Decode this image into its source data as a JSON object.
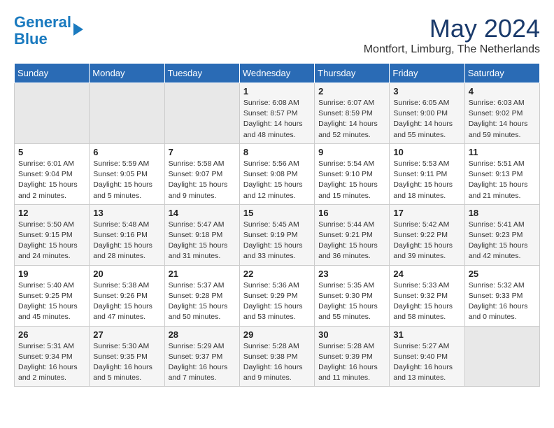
{
  "logo": {
    "line1": "General",
    "line2": "Blue"
  },
  "title": "May 2024",
  "location": "Montfort, Limburg, The Netherlands",
  "days_of_week": [
    "Sunday",
    "Monday",
    "Tuesday",
    "Wednesday",
    "Thursday",
    "Friday",
    "Saturday"
  ],
  "weeks": [
    [
      {
        "day": "",
        "info": ""
      },
      {
        "day": "",
        "info": ""
      },
      {
        "day": "",
        "info": ""
      },
      {
        "day": "1",
        "info": "Sunrise: 6:08 AM\nSunset: 8:57 PM\nDaylight: 14 hours\nand 48 minutes."
      },
      {
        "day": "2",
        "info": "Sunrise: 6:07 AM\nSunset: 8:59 PM\nDaylight: 14 hours\nand 52 minutes."
      },
      {
        "day": "3",
        "info": "Sunrise: 6:05 AM\nSunset: 9:00 PM\nDaylight: 14 hours\nand 55 minutes."
      },
      {
        "day": "4",
        "info": "Sunrise: 6:03 AM\nSunset: 9:02 PM\nDaylight: 14 hours\nand 59 minutes."
      }
    ],
    [
      {
        "day": "5",
        "info": "Sunrise: 6:01 AM\nSunset: 9:04 PM\nDaylight: 15 hours\nand 2 minutes."
      },
      {
        "day": "6",
        "info": "Sunrise: 5:59 AM\nSunset: 9:05 PM\nDaylight: 15 hours\nand 5 minutes."
      },
      {
        "day": "7",
        "info": "Sunrise: 5:58 AM\nSunset: 9:07 PM\nDaylight: 15 hours\nand 9 minutes."
      },
      {
        "day": "8",
        "info": "Sunrise: 5:56 AM\nSunset: 9:08 PM\nDaylight: 15 hours\nand 12 minutes."
      },
      {
        "day": "9",
        "info": "Sunrise: 5:54 AM\nSunset: 9:10 PM\nDaylight: 15 hours\nand 15 minutes."
      },
      {
        "day": "10",
        "info": "Sunrise: 5:53 AM\nSunset: 9:11 PM\nDaylight: 15 hours\nand 18 minutes."
      },
      {
        "day": "11",
        "info": "Sunrise: 5:51 AM\nSunset: 9:13 PM\nDaylight: 15 hours\nand 21 minutes."
      }
    ],
    [
      {
        "day": "12",
        "info": "Sunrise: 5:50 AM\nSunset: 9:15 PM\nDaylight: 15 hours\nand 24 minutes."
      },
      {
        "day": "13",
        "info": "Sunrise: 5:48 AM\nSunset: 9:16 PM\nDaylight: 15 hours\nand 28 minutes."
      },
      {
        "day": "14",
        "info": "Sunrise: 5:47 AM\nSunset: 9:18 PM\nDaylight: 15 hours\nand 31 minutes."
      },
      {
        "day": "15",
        "info": "Sunrise: 5:45 AM\nSunset: 9:19 PM\nDaylight: 15 hours\nand 33 minutes."
      },
      {
        "day": "16",
        "info": "Sunrise: 5:44 AM\nSunset: 9:21 PM\nDaylight: 15 hours\nand 36 minutes."
      },
      {
        "day": "17",
        "info": "Sunrise: 5:42 AM\nSunset: 9:22 PM\nDaylight: 15 hours\nand 39 minutes."
      },
      {
        "day": "18",
        "info": "Sunrise: 5:41 AM\nSunset: 9:23 PM\nDaylight: 15 hours\nand 42 minutes."
      }
    ],
    [
      {
        "day": "19",
        "info": "Sunrise: 5:40 AM\nSunset: 9:25 PM\nDaylight: 15 hours\nand 45 minutes."
      },
      {
        "day": "20",
        "info": "Sunrise: 5:38 AM\nSunset: 9:26 PM\nDaylight: 15 hours\nand 47 minutes."
      },
      {
        "day": "21",
        "info": "Sunrise: 5:37 AM\nSunset: 9:28 PM\nDaylight: 15 hours\nand 50 minutes."
      },
      {
        "day": "22",
        "info": "Sunrise: 5:36 AM\nSunset: 9:29 PM\nDaylight: 15 hours\nand 53 minutes."
      },
      {
        "day": "23",
        "info": "Sunrise: 5:35 AM\nSunset: 9:30 PM\nDaylight: 15 hours\nand 55 minutes."
      },
      {
        "day": "24",
        "info": "Sunrise: 5:33 AM\nSunset: 9:32 PM\nDaylight: 15 hours\nand 58 minutes."
      },
      {
        "day": "25",
        "info": "Sunrise: 5:32 AM\nSunset: 9:33 PM\nDaylight: 16 hours\nand 0 minutes."
      }
    ],
    [
      {
        "day": "26",
        "info": "Sunrise: 5:31 AM\nSunset: 9:34 PM\nDaylight: 16 hours\nand 2 minutes."
      },
      {
        "day": "27",
        "info": "Sunrise: 5:30 AM\nSunset: 9:35 PM\nDaylight: 16 hours\nand 5 minutes."
      },
      {
        "day": "28",
        "info": "Sunrise: 5:29 AM\nSunset: 9:37 PM\nDaylight: 16 hours\nand 7 minutes."
      },
      {
        "day": "29",
        "info": "Sunrise: 5:28 AM\nSunset: 9:38 PM\nDaylight: 16 hours\nand 9 minutes."
      },
      {
        "day": "30",
        "info": "Sunrise: 5:28 AM\nSunset: 9:39 PM\nDaylight: 16 hours\nand 11 minutes."
      },
      {
        "day": "31",
        "info": "Sunrise: 5:27 AM\nSunset: 9:40 PM\nDaylight: 16 hours\nand 13 minutes."
      },
      {
        "day": "",
        "info": ""
      }
    ]
  ]
}
